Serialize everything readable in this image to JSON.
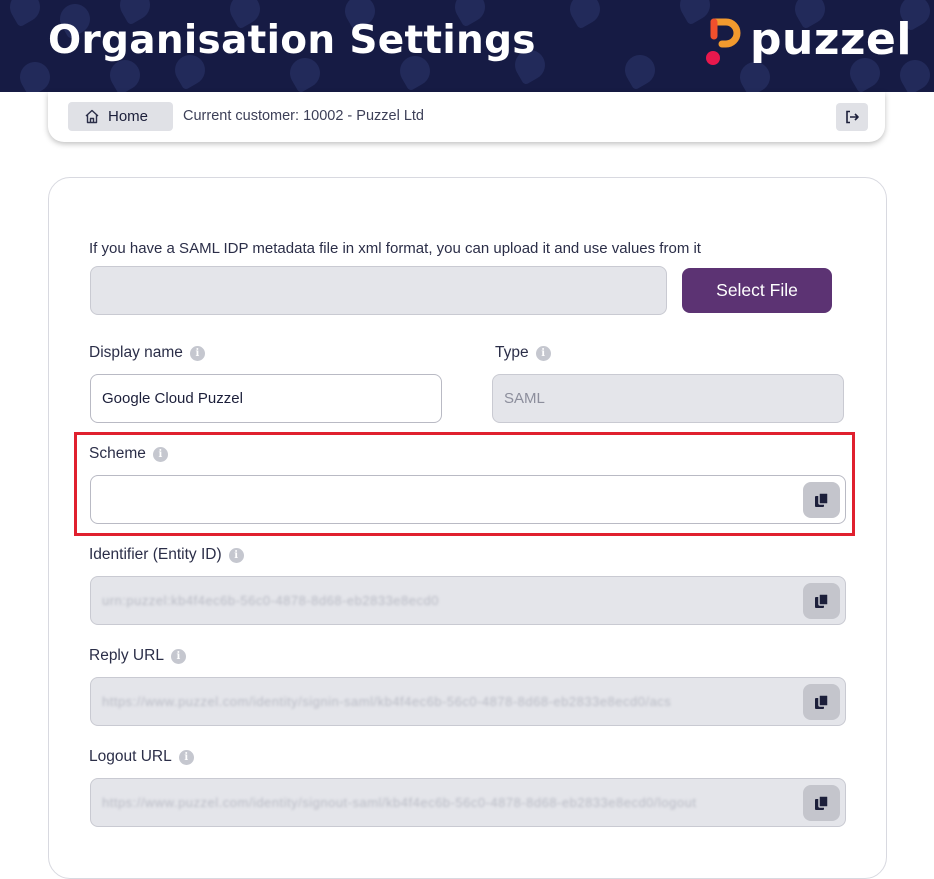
{
  "header": {
    "title": "Organisation Settings",
    "brand": "puzzel",
    "background_color": "#161b44",
    "logo_colors": [
      "#f0502d",
      "#f5a623",
      "#e8184d"
    ]
  },
  "breadcrumb": {
    "home_label": "Home",
    "home_icon": "home-icon",
    "customer_text": "Current customer: 10002 - Puzzel Ltd",
    "logout_icon": "logout-icon"
  },
  "form": {
    "upload_hint": "If you have a SAML IDP metadata file in xml format, you can upload it and use values from it",
    "file_input_value": "",
    "select_file_label": "Select File",
    "select_file_color": "#5c3373",
    "display_name": {
      "label": "Display name",
      "value": "Google Cloud Puzzel"
    },
    "type": {
      "label": "Type",
      "value": "SAML"
    },
    "scheme": {
      "label": "Scheme",
      "value": ""
    },
    "identifier": {
      "label": "Identifier (Entity ID)",
      "value": "urn:puzzel:kb4f4ec6b-56c0-4878-8d68-eb2833e8ecd0"
    },
    "reply_url": {
      "label": "Reply URL",
      "value": "https://www.puzzel.com/identity/signin-saml/kb4f4ec6b-56c0-4878-8d68-eb2833e8ecd0/acs"
    },
    "logout_url": {
      "label": "Logout URL",
      "value": "https://www.puzzel.com/identity/signout-saml/kb4f4ec6b-56c0-4878-8d68-eb2833e8ecd0/logout"
    },
    "info_icon_glyph": "i",
    "copy_icon": "copy-icon",
    "highlight_color": "#e0202e"
  }
}
